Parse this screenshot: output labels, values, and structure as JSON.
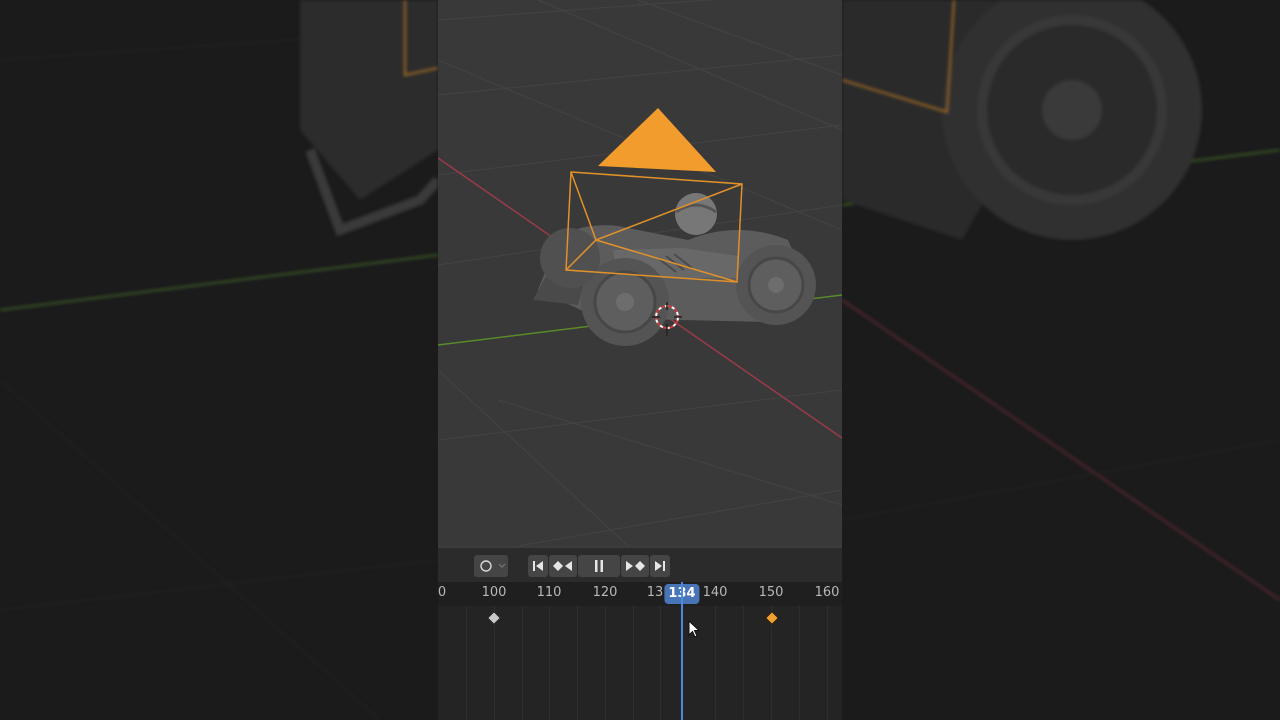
{
  "viewport": {
    "colors": {
      "background": "#393939",
      "selection": "#f0a030",
      "x_axis": "#9a3a4a",
      "y_axis": "#5a8a2a"
    }
  },
  "timeline": {
    "controls": {
      "keying_icon": "circle-icon",
      "jump_start_icon": "skip-start-icon",
      "prev_keyframe_icon": "prev-keyframe-icon",
      "pause_icon": "pause-icon",
      "next_keyframe_icon": "next-keyframe-icon",
      "jump_end_icon": "skip-end-icon"
    },
    "ruler": {
      "labels": [
        "0",
        "100",
        "110",
        "120",
        "13",
        "140",
        "150",
        "160"
      ]
    },
    "current_frame": "134",
    "keyframes": [
      {
        "frame": 100,
        "selected": false,
        "color": "#c8c8c8"
      },
      {
        "frame": 150,
        "selected": true,
        "color": "#f0a030"
      }
    ],
    "colors": {
      "playhead": "#4a8ae0",
      "frame_badge": "#4775b8"
    }
  }
}
